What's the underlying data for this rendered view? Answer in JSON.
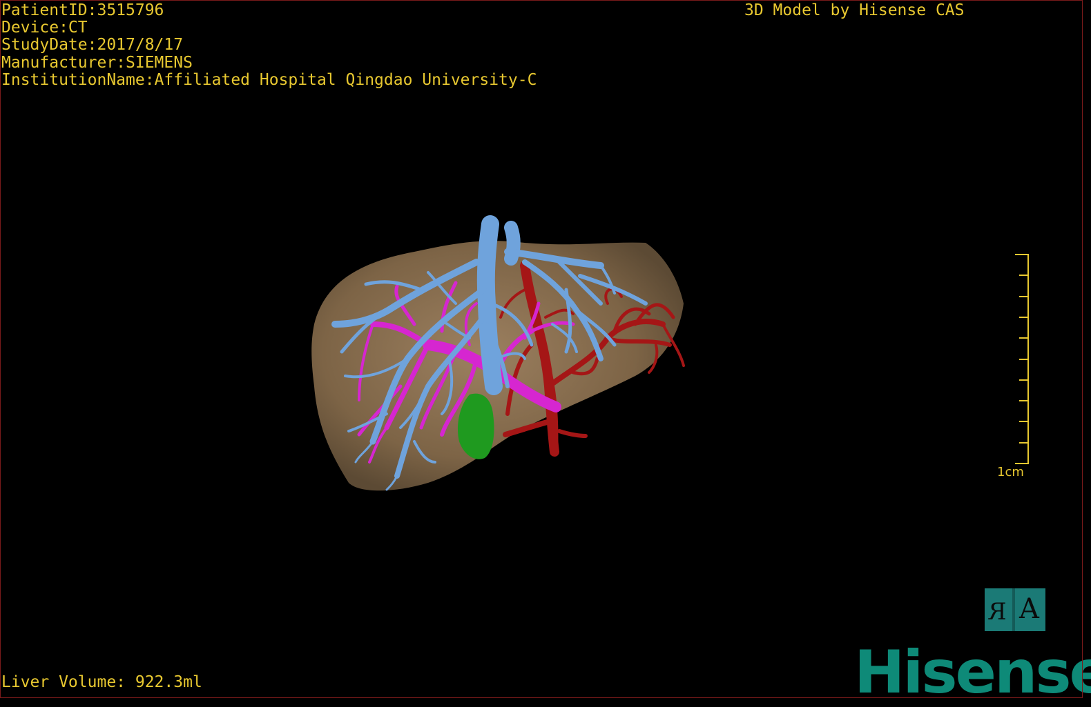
{
  "header": {
    "patient_id": "PatientID:3515796",
    "device": "Device:CT",
    "study_date": "StudyDate:2017/8/17",
    "manufacturer": "Manufacturer:SIEMENS",
    "institution": "InstitutionName:Affiliated Hospital Qingdao University-C",
    "model_by": "3D Model by Hisense CAS"
  },
  "footer": {
    "liver_volume": "Liver Volume: 922.3ml"
  },
  "scale": {
    "label": "1cm",
    "ticks": 10
  },
  "orientation": {
    "left_label": "R",
    "right_label": "A"
  },
  "logo": {
    "text": "Hisense"
  },
  "colors": {
    "overlay_text": "#e8c830",
    "liver": "#8a7050",
    "hepatic_vein": "#6fa3dc",
    "portal_vein": "#d626d0",
    "hepatic_artery": "#a51616",
    "gallbladder": "#1f9a1f",
    "brand": "#0e8a78"
  }
}
